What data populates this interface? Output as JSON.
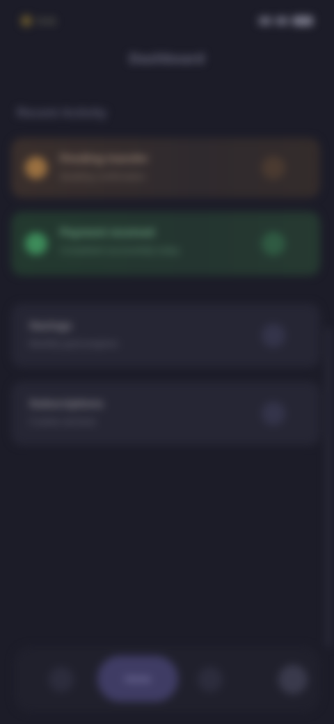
{
  "status_bar": {
    "time": "9:41"
  },
  "header": {
    "title": "Dashboard"
  },
  "section": {
    "title": "Recent Activity"
  },
  "cards": [
    {
      "name": "Pending transfer",
      "subtitle": "Awaiting confirmation",
      "color": "#9a7040"
    },
    {
      "name": "Payment received",
      "subtitle": "Completed successfully today",
      "color": "#3d8c5a"
    },
    {
      "name": "Savings",
      "subtitle": "Monthly goal progress",
      "color": "#34344a"
    },
    {
      "name": "Subscriptions",
      "subtitle": "3 active services",
      "color": "#34344a"
    }
  ],
  "bottom_nav": {
    "main_label": "Home"
  },
  "icons": {
    "status": "signal-icon",
    "battery": "battery-icon",
    "home": "home-icon",
    "chart": "chart-icon",
    "profile": "profile-icon"
  },
  "colors": {
    "background": "#1c1c28",
    "accent": "#3f3c64"
  }
}
